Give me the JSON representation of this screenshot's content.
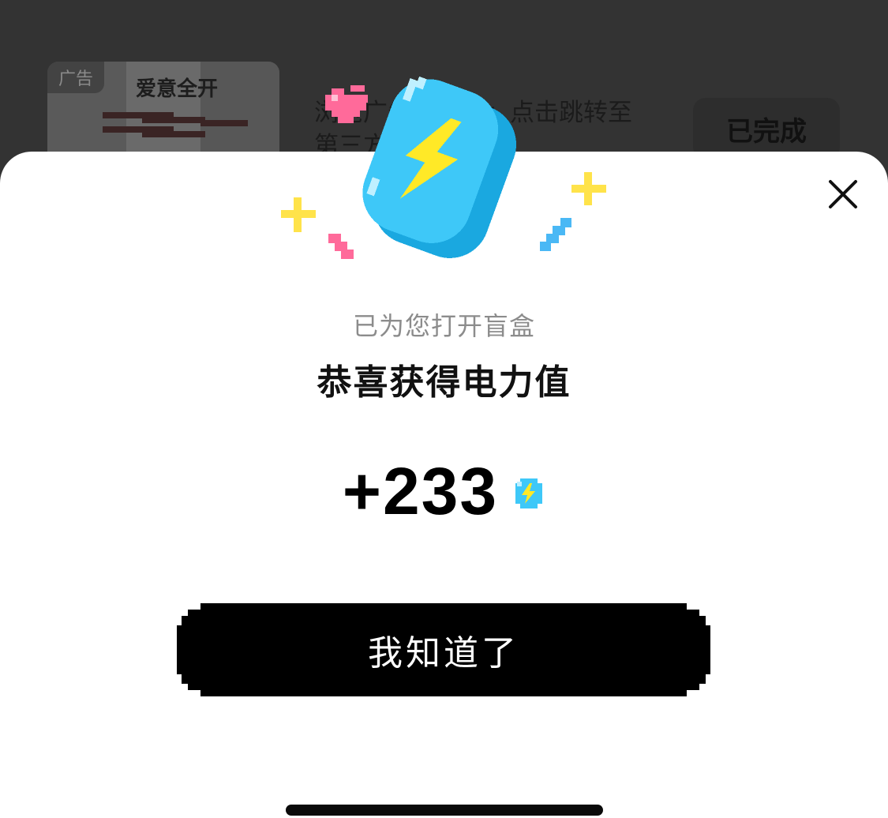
{
  "background": {
    "ad_tag": "广告",
    "ad_brand": "爱意全开",
    "task_text": "浏览广告「推荐」点击跳转至第三方应用",
    "done_label": "已完成"
  },
  "modal": {
    "subtitle": "已为您打开盲盒",
    "title": "恭喜获得电力值",
    "reward_value": "+233",
    "reward_icon": "energy-coin-icon",
    "confirm_label": "我知道了",
    "close_icon": "close-icon"
  },
  "colors": {
    "coin_blue": "#3EC8F8",
    "bolt_yellow": "#FFE927",
    "heart_pink": "#FF6A9A",
    "button_black": "#000000"
  }
}
